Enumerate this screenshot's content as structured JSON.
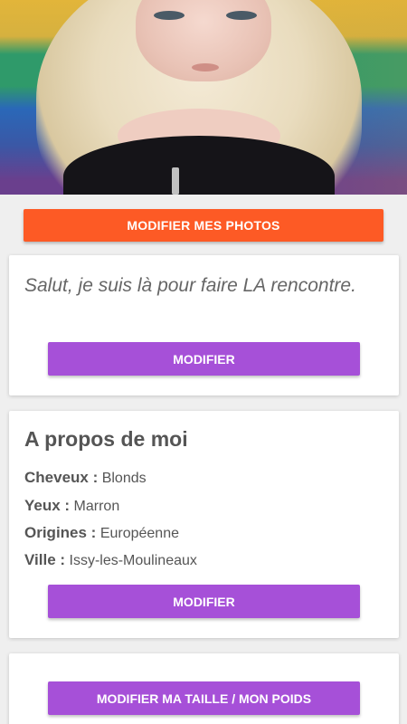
{
  "photo": {
    "alt": "profile-photo"
  },
  "actions": {
    "edit_photos_label": "MODIFIER MES PHOTOS"
  },
  "bio": {
    "text": "Salut, je suis là pour faire LA rencontre.",
    "edit_label": "MODIFIER"
  },
  "about": {
    "title": "A propos de moi",
    "attributes": [
      {
        "key": "Cheveux :",
        "value": "Blonds"
      },
      {
        "key": "Yeux :",
        "value": "Marron"
      },
      {
        "key": "Origines :",
        "value": "Européenne"
      },
      {
        "key": "Ville :",
        "value": "Issy-les-Moulineaux"
      }
    ],
    "edit_label": "MODIFIER"
  },
  "size_weight": {
    "edit_label": "MODIFIER MA TAILLE / MON POIDS"
  },
  "colors": {
    "orange": "#fd5a25",
    "purple": "#a650d8"
  }
}
